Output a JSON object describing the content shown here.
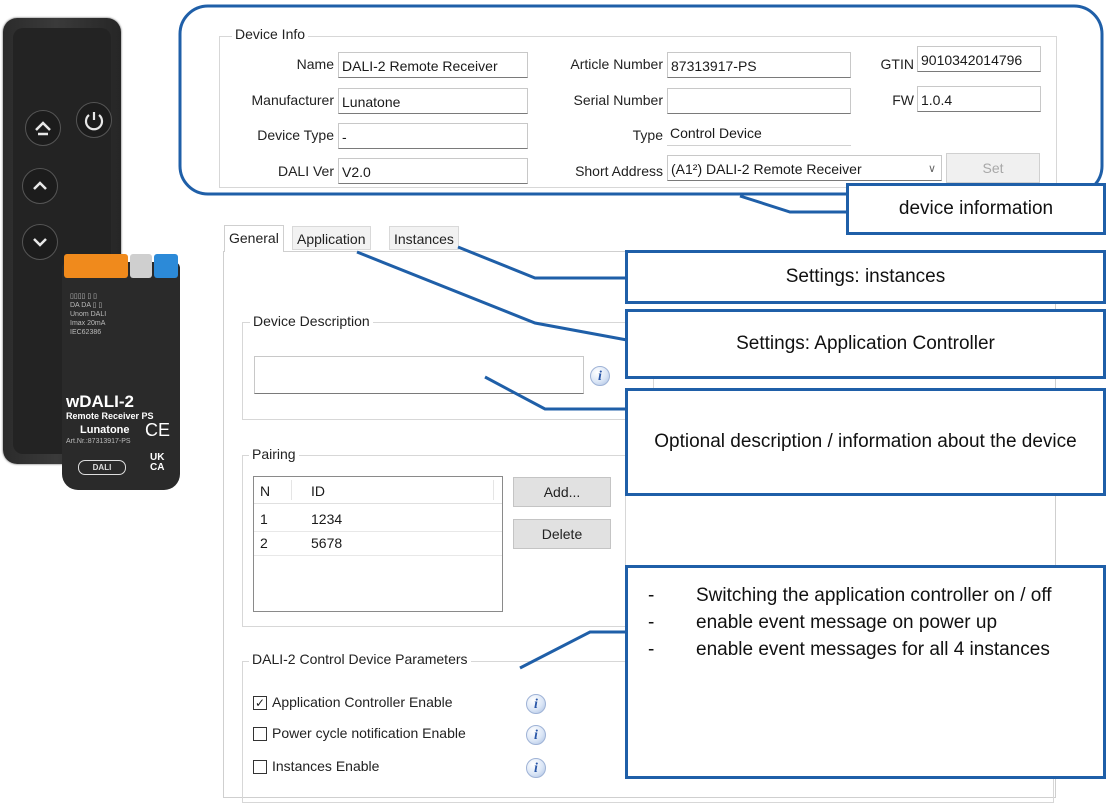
{
  "device_info": {
    "title": "Device Info",
    "name_label": "Name",
    "name_value": "DALI-2 Remote Receiver",
    "manufacturer_label": "Manufacturer",
    "manufacturer_value": "Lunatone",
    "device_type_label": "Device Type",
    "device_type_value": "-",
    "dali_ver_label": "DALI Ver",
    "dali_ver_value": "V2.0",
    "article_label": "Article Number",
    "article_value": "87313917-PS",
    "serial_label": "Serial Number",
    "serial_value": "",
    "type_label": "Type",
    "type_value": "Control Device",
    "short_address_label": "Short Address",
    "short_address_value": "(A1²) DALI-2 Remote Receiver",
    "gtin_label": "GTIN",
    "gtin_value": "9010342014796",
    "fw_label": "FW",
    "fw_value": "1.0.4",
    "set_button": "Set"
  },
  "tabs": [
    "General",
    "Application",
    "Instances"
  ],
  "device_description": {
    "title": "Device Description",
    "value": ""
  },
  "pairing": {
    "title": "Pairing",
    "columns": [
      "N",
      "ID"
    ],
    "rows": [
      {
        "n": "1",
        "id": "1234"
      },
      {
        "n": "2",
        "id": "5678"
      }
    ],
    "add_button": "Add...",
    "delete_button": "Delete"
  },
  "parameters": {
    "title": "DALI-2 Control Device Parameters",
    "items": [
      {
        "label": "Application Controller Enable",
        "checked": true
      },
      {
        "label": "Power cycle notification Enable",
        "checked": false
      },
      {
        "label": "Instances Enable",
        "checked": false
      }
    ]
  },
  "callouts": {
    "device_information": "device information",
    "instances": "Settings: instances",
    "application": "Settings: Application Controller",
    "description": "Optional description / information about the device",
    "params_bullets": [
      "Switching the application controller on / off",
      "enable event message on power up",
      "enable event messages for all 4 instances"
    ]
  },
  "product": {
    "model": "wDALI-2",
    "subtitle": "Remote Receiver PS",
    "brand": "Lunatone",
    "article": "Art.Nr.:87313917-PS",
    "dali_logo": "DALI",
    "ce_mark": "CE",
    "ukca_mark": "UK CA"
  },
  "colors": {
    "accent": "#1f5fa8",
    "remote_body": "#2b2b2b",
    "terminal_orange": "#f08a1c",
    "terminal_blue": "#2c8ad8"
  },
  "icons": {
    "info": "info-icon",
    "power": "power-icon",
    "up": "chevron-up-icon",
    "down": "chevron-down-icon",
    "home": "home-arrow-icon"
  }
}
